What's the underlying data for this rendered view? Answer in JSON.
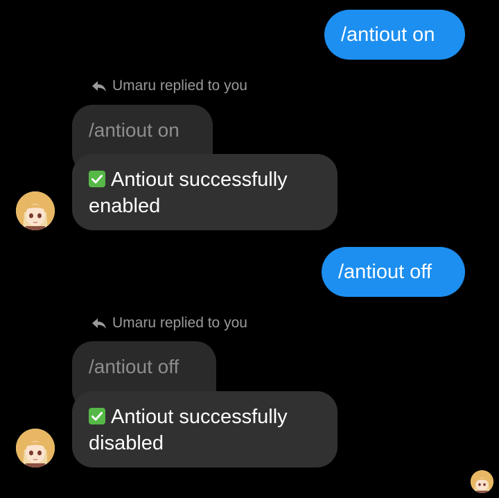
{
  "conversation": {
    "messages": [
      {
        "type": "sent",
        "text": "/antiout on"
      },
      {
        "type": "reply",
        "reply_label": "Umaru replied to you",
        "quoted_text": "/antiout on",
        "body_line1": "Antiout successfully",
        "body_line2": "enabled",
        "status_icon": "check-mark-button-icon",
        "avatar": "umaru-avatar"
      },
      {
        "type": "sent",
        "text": "/antiout off"
      },
      {
        "type": "reply",
        "reply_label": "Umaru replied to you",
        "quoted_text": "/antiout off",
        "body_line1": "Antiout successfully",
        "body_line2": "disabled",
        "status_icon": "check-mark-button-icon",
        "avatar": "umaru-avatar"
      }
    ],
    "seen_indicator": "umaru-avatar"
  },
  "colors": {
    "background": "#000000",
    "sent_bubble": "#1d8ff0",
    "received_bubble": "#313131",
    "quoted_bubble": "#2a2a2a",
    "check_green": "#56b847"
  }
}
